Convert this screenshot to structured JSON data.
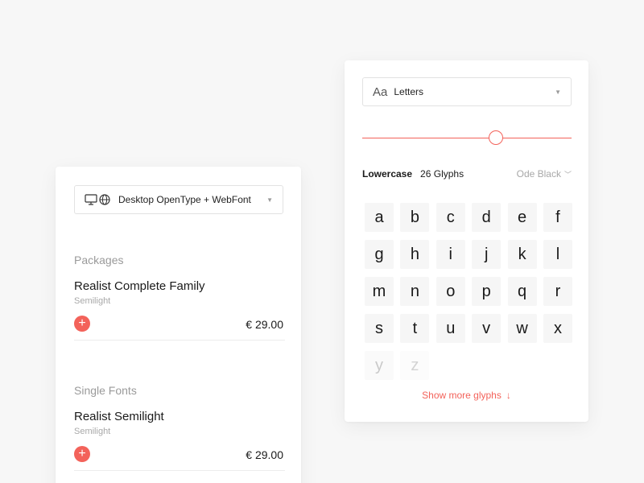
{
  "license": {
    "label": "Desktop OpenType + WebFont",
    "icons": [
      "desktop-icon",
      "globe-icon"
    ]
  },
  "packages": {
    "title": "Packages",
    "item": {
      "name": "Realist Complete Family",
      "style": "Semilight",
      "price": "€ 29.00"
    }
  },
  "single_fonts": {
    "title": "Single Fonts",
    "item": {
      "name": "Realist Semilight",
      "style": "Semilight",
      "price": "€ 29.00"
    }
  },
  "glyph_panel": {
    "select_icon": "Aa",
    "select_label": "Letters",
    "size_slider_fraction": 0.64,
    "category": "Lowercase",
    "count": "26 Glyphs",
    "style_select": "Ode Black",
    "glyphs": [
      "a",
      "b",
      "c",
      "d",
      "e",
      "f",
      "g",
      "h",
      "i",
      "j",
      "k",
      "l",
      "m",
      "n",
      "o",
      "p",
      "q",
      "r",
      "s",
      "t",
      "u",
      "v",
      "w",
      "x",
      "y",
      "z"
    ],
    "show_more": "Show more glyphs"
  },
  "colors": {
    "accent": "#f3625a",
    "background": "#f7f7f7",
    "card": "#ffffff"
  }
}
